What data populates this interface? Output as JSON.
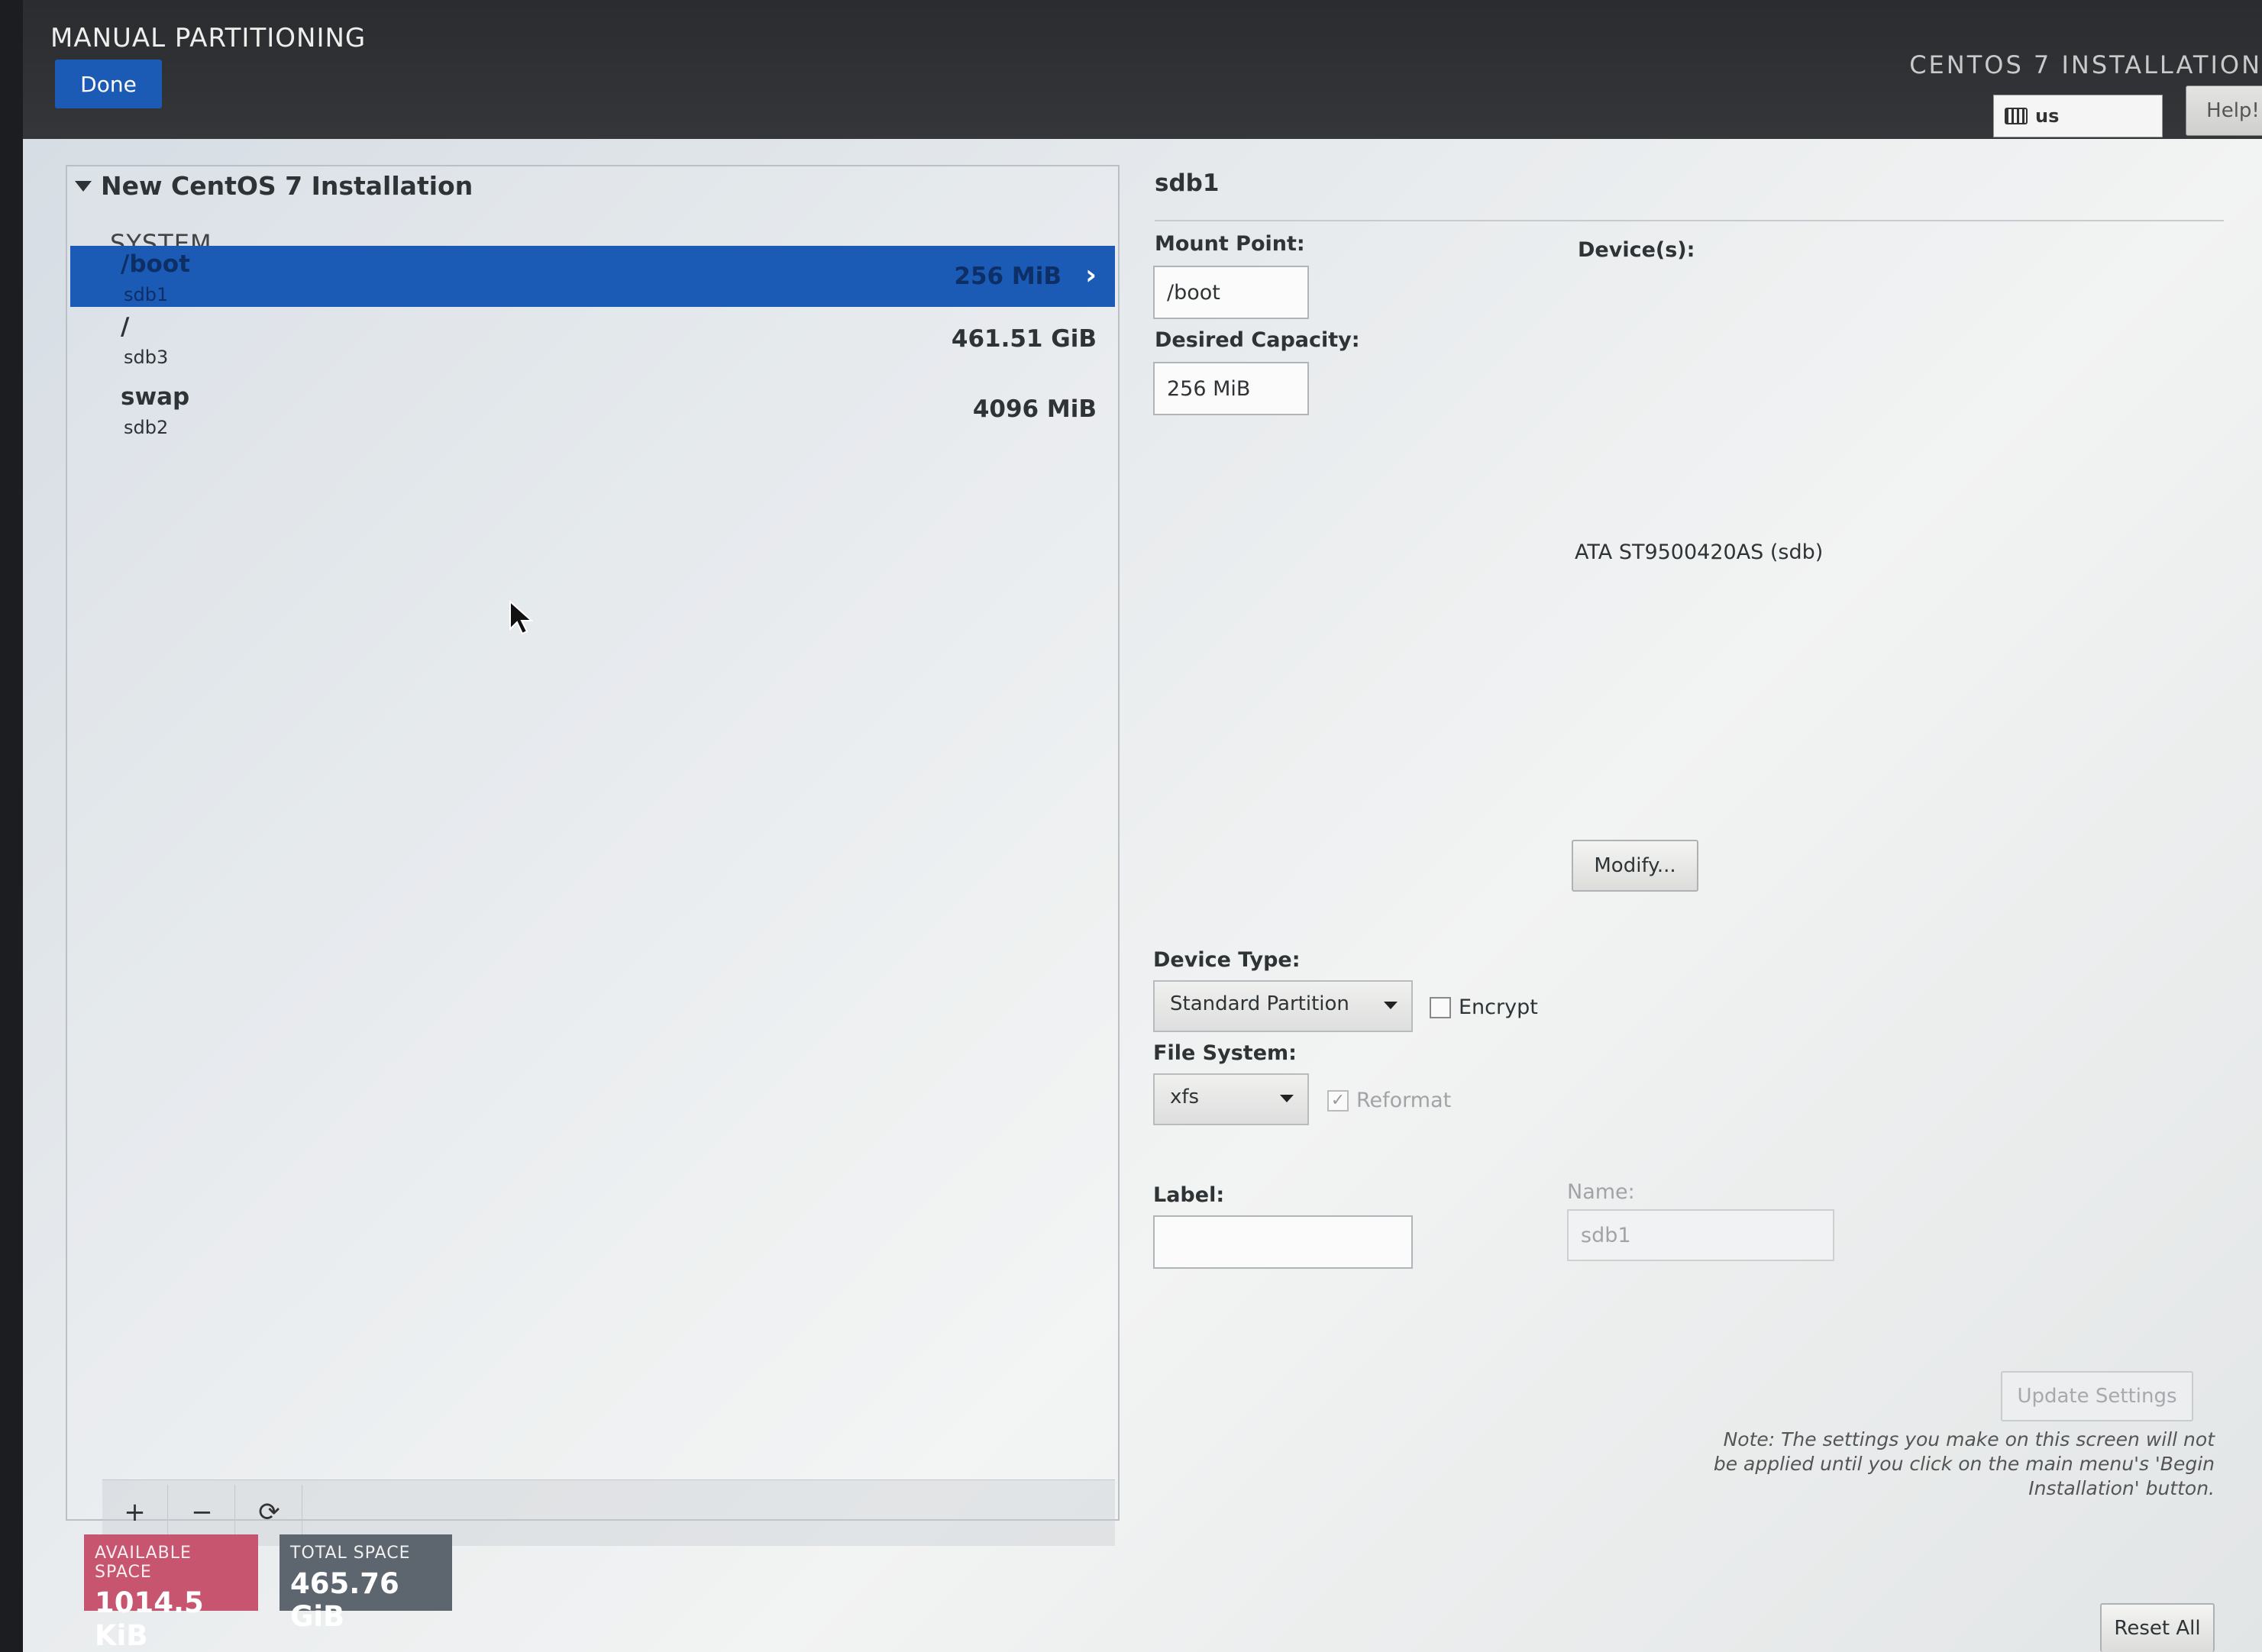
{
  "header": {
    "title": "MANUAL PARTITIONING",
    "done_label": "Done",
    "product": "CENTOS 7 INSTALLATION",
    "keyboard_layout": "us",
    "help_label": "Help!"
  },
  "partitions": {
    "group_title": "New CentOS 7 Installation",
    "section": "SYSTEM",
    "items": [
      {
        "mount": "/boot",
        "device": "sdb1",
        "size": "256 MiB",
        "selected": true
      },
      {
        "mount": "/",
        "device": "sdb3",
        "size": "461.51 GiB",
        "selected": false
      },
      {
        "mount": "swap",
        "device": "sdb2",
        "size": "4096 MiB",
        "selected": false
      }
    ],
    "toolbar": {
      "add": "+",
      "remove": "−",
      "refresh": "⟳"
    }
  },
  "space": {
    "available_label": "AVAILABLE SPACE",
    "available_value": "1014.5 KiB",
    "total_label": "TOTAL SPACE",
    "total_value": "465.76 GiB"
  },
  "details": {
    "device_name": "sdb1",
    "mount_point_label": "Mount Point:",
    "mount_point_value": "/boot",
    "capacity_label": "Desired Capacity:",
    "capacity_value": "256 MiB",
    "devices_label": "Device(s):",
    "device_desc": "ATA ST9500420AS (sdb)",
    "modify_label": "Modify...",
    "device_type_label": "Device Type:",
    "device_type_value": "Standard Partition",
    "encrypt_label": "Encrypt",
    "filesystem_label": "File System:",
    "filesystem_value": "xfs",
    "reformat_label": "Reformat",
    "label_label": "Label:",
    "label_value": "",
    "name_label": "Name:",
    "name_value": "sdb1",
    "update_label": "Update Settings",
    "note": "Note:  The settings you make on this screen will not be applied until you click on the main menu's 'Begin Installation' button.",
    "reset_label": "Reset All"
  },
  "colors": {
    "accent": "#1c5bb5",
    "available": "#c8556f",
    "total": "#5d666e"
  }
}
